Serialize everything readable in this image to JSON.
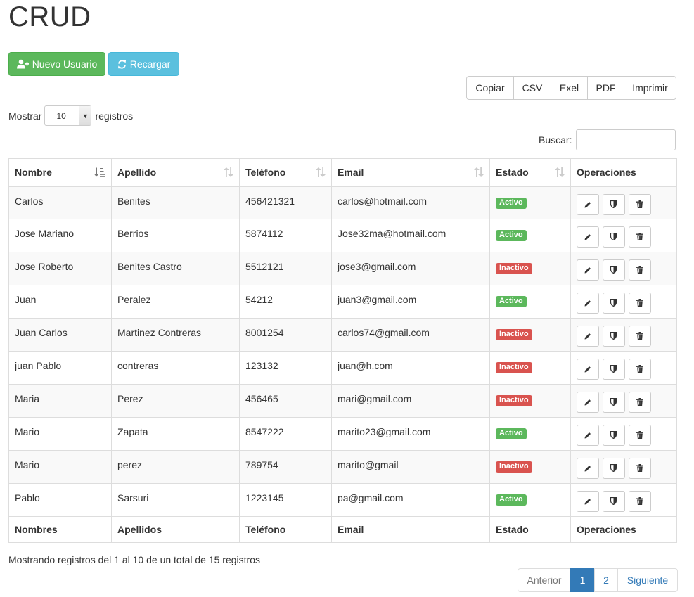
{
  "title": "CRUD",
  "toolbar": {
    "new_user": "Nuevo Usuario",
    "reload": "Recargar"
  },
  "export_buttons": [
    "Copiar",
    "CSV",
    "Exel",
    "PDF",
    "Imprimir"
  ],
  "length": {
    "label_before": "Mostrar",
    "value": "10",
    "label_after": "registros"
  },
  "search": {
    "label": "Buscar:",
    "value": ""
  },
  "table": {
    "headers": [
      "Nombre",
      "Apellido",
      "Teléfono",
      "Email",
      "Estado",
      "Operaciones"
    ],
    "footers": [
      "Nombres",
      "Apellidos",
      "Teléfono",
      "Email",
      "Estado",
      "Operaciones"
    ],
    "rows": [
      {
        "nombre": "Carlos",
        "apellido": "Benites",
        "telefono": "456421321",
        "email": "carlos@hotmail.com",
        "estado": "Activo"
      },
      {
        "nombre": "Jose Mariano",
        "apellido": "Berrios",
        "telefono": "5874112",
        "email": "Jose32ma@hotmail.com",
        "estado": "Activo"
      },
      {
        "nombre": "Jose Roberto",
        "apellido": "Benites Castro",
        "telefono": "5512121",
        "email": "jose3@gmail.com",
        "estado": "Inactivo"
      },
      {
        "nombre": "Juan",
        "apellido": "Peralez",
        "telefono": "54212",
        "email": "juan3@gmail.com",
        "estado": "Activo"
      },
      {
        "nombre": "Juan Carlos",
        "apellido": "Martinez Contreras",
        "telefono": "8001254",
        "email": "carlos74@gmail.com",
        "estado": "Inactivo"
      },
      {
        "nombre": "juan Pablo",
        "apellido": "contreras",
        "telefono": "123132",
        "email": "juan@h.com",
        "estado": "Inactivo"
      },
      {
        "nombre": "Maria",
        "apellido": "Perez",
        "telefono": "456465",
        "email": "mari@gmail.com",
        "estado": "Inactivo"
      },
      {
        "nombre": "Mario",
        "apellido": "Zapata",
        "telefono": "8547222",
        "email": "marito23@gmail.com",
        "estado": "Activo"
      },
      {
        "nombre": "Mario",
        "apellido": "perez",
        "telefono": "789754",
        "email": "marito@gmail",
        "estado": "Inactivo"
      },
      {
        "nombre": "Pablo",
        "apellido": "Sarsuri",
        "telefono": "1223145",
        "email": "pa@gmail.com",
        "estado": "Activo"
      }
    ]
  },
  "info": "Mostrando registros del 1 al 10 de un total de 15 registros",
  "pagination": {
    "prev": "Anterior",
    "pages": [
      "1",
      "2"
    ],
    "active": "1",
    "next": "Siguiente"
  },
  "colors": {
    "success": "#5cb85c",
    "info": "#5bc0de",
    "danger": "#d9534f",
    "primary": "#337ab7"
  },
  "icons": {
    "new_user": "user-plus-icon",
    "reload": "refresh-icon",
    "sort_active": "sort-alpha-asc-icon",
    "sort": "sort-icon",
    "edit": "pencil-icon",
    "toggle": "shield-icon",
    "delete": "trash-icon"
  }
}
